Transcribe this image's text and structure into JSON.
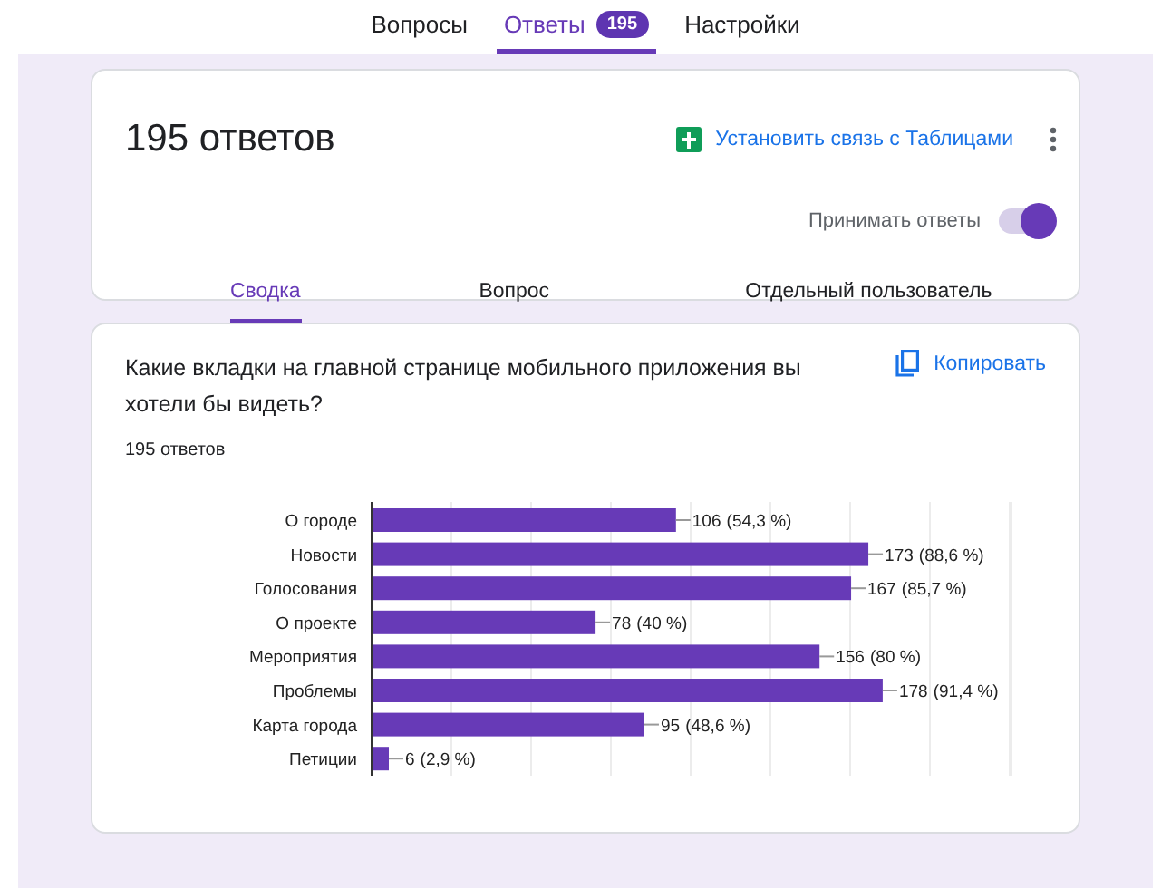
{
  "top_tabs": [
    {
      "label": "Вопросы",
      "selected": false
    },
    {
      "label": "Ответы",
      "selected": true,
      "badge": "195"
    },
    {
      "label": "Настройки",
      "selected": false
    }
  ],
  "summary": {
    "title": "195 ответов",
    "sheets_link": "Установить связь с Таблицами",
    "accepting": {
      "label": "Принимать ответы",
      "on": true
    },
    "tabs": [
      {
        "label": "Сводка",
        "selected": true
      },
      {
        "label": "Вопрос",
        "selected": false
      },
      {
        "label": "Отдельный пользователь",
        "selected": false
      }
    ]
  },
  "question": {
    "title": "Какие вкладки на главной странице мобильного приложения вы хотели бы видеть?",
    "copy": "Копировать",
    "count": "195 ответов",
    "chart_data": {
      "type": "bar",
      "orientation": "horizontal",
      "categories": [
        "О городе",
        "Новости",
        "Голосования",
        "О проекте",
        "Мероприятия",
        "Проблемы",
        "Карта города",
        "Петиции"
      ],
      "series": [
        {
          "color": "#673ab7",
          "values": [
            106,
            173,
            167,
            78,
            156,
            178,
            95,
            6
          ]
        }
      ],
      "data_labels": true
    },
    "percent_labels": [
      "(54,3 %)",
      "(88,6 %)",
      "(85,7 %)",
      "(40 %)",
      "(80 %)",
      "(91,4 %)",
      "(48,6 %)",
      "(2,9 %)"
    ]
  }
}
